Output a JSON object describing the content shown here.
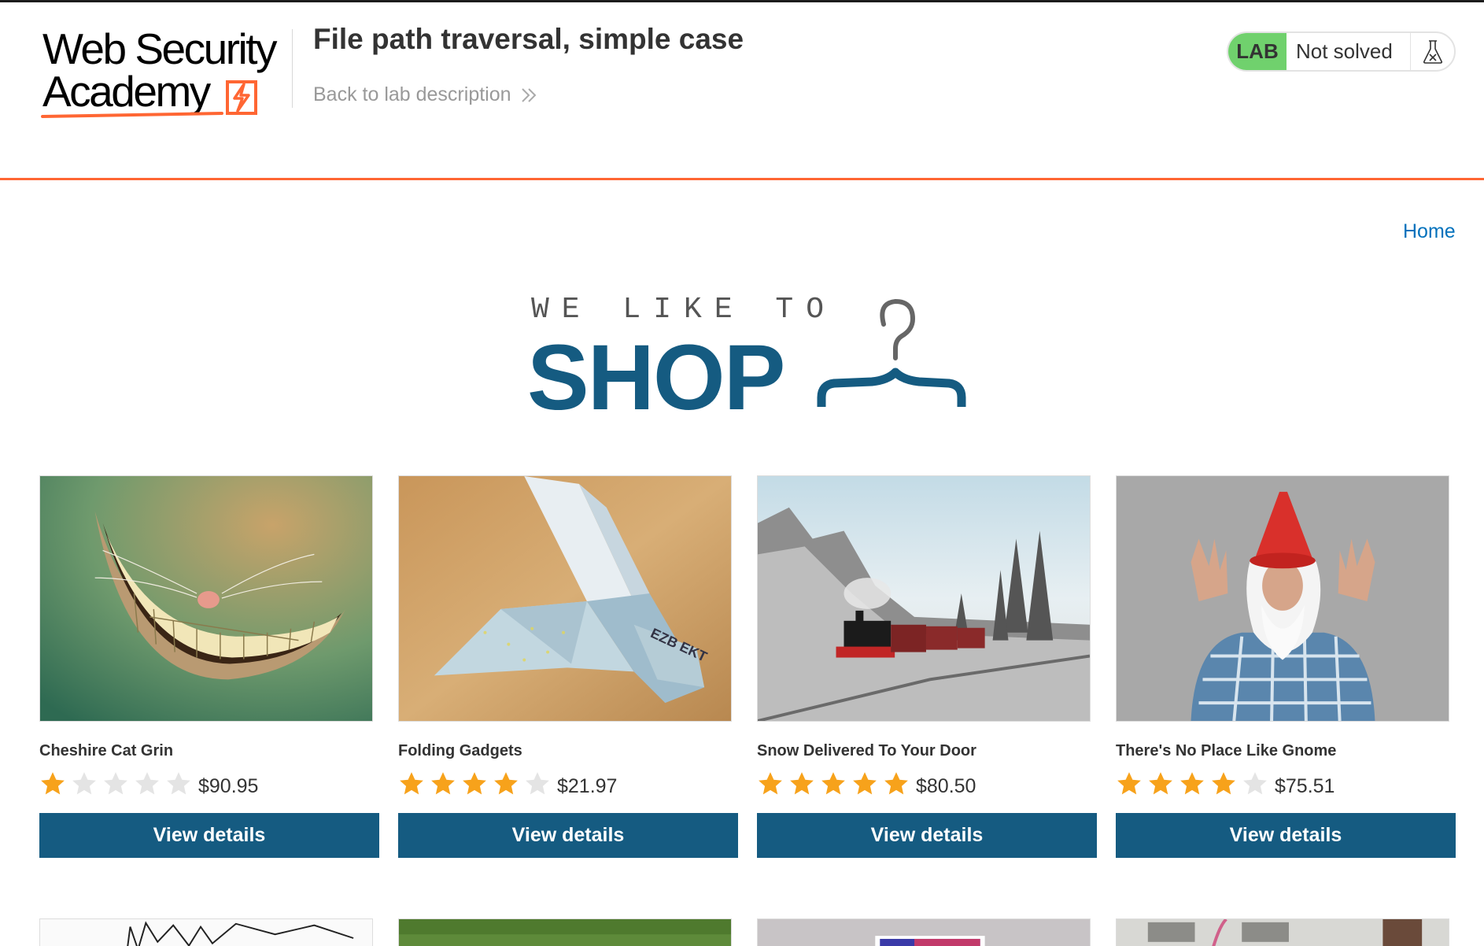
{
  "header": {
    "logo_line1": "Web Security",
    "logo_line2": "Academy",
    "lab_title": "File path traversal, simple case",
    "back_link": "Back to lab description",
    "status_badge": "LAB",
    "status_text": "Not solved",
    "accent_color": "#ff6633",
    "solved_color": "#70d16d"
  },
  "nav": {
    "home": "Home"
  },
  "banner": {
    "tagline": "WE LIKE TO",
    "shop": "SHOP",
    "brand_color": "#155b81"
  },
  "products": [
    {
      "name": "Cheshire Cat Grin",
      "rating": 1,
      "price": "$90.95",
      "button": "View details",
      "image": "cheshire-cat-grin-image"
    },
    {
      "name": "Folding Gadgets",
      "rating": 4,
      "price": "$21.97",
      "button": "View details",
      "image": "origami-bird-image"
    },
    {
      "name": "Snow Delivered To Your Door",
      "rating": 5,
      "price": "$80.50",
      "button": "View details",
      "image": "snowy-train-image"
    },
    {
      "name": "There's No Place Like Gnome",
      "rating": 4,
      "price": "$75.51",
      "button": "View details",
      "image": "gnome-costume-image"
    }
  ],
  "rating_max": 5,
  "icons": {
    "flask": "flask-icon",
    "chevrons": "double-chevron-right-icon",
    "star_on": "#f7a21b",
    "star_off": "#e4e4e4"
  }
}
